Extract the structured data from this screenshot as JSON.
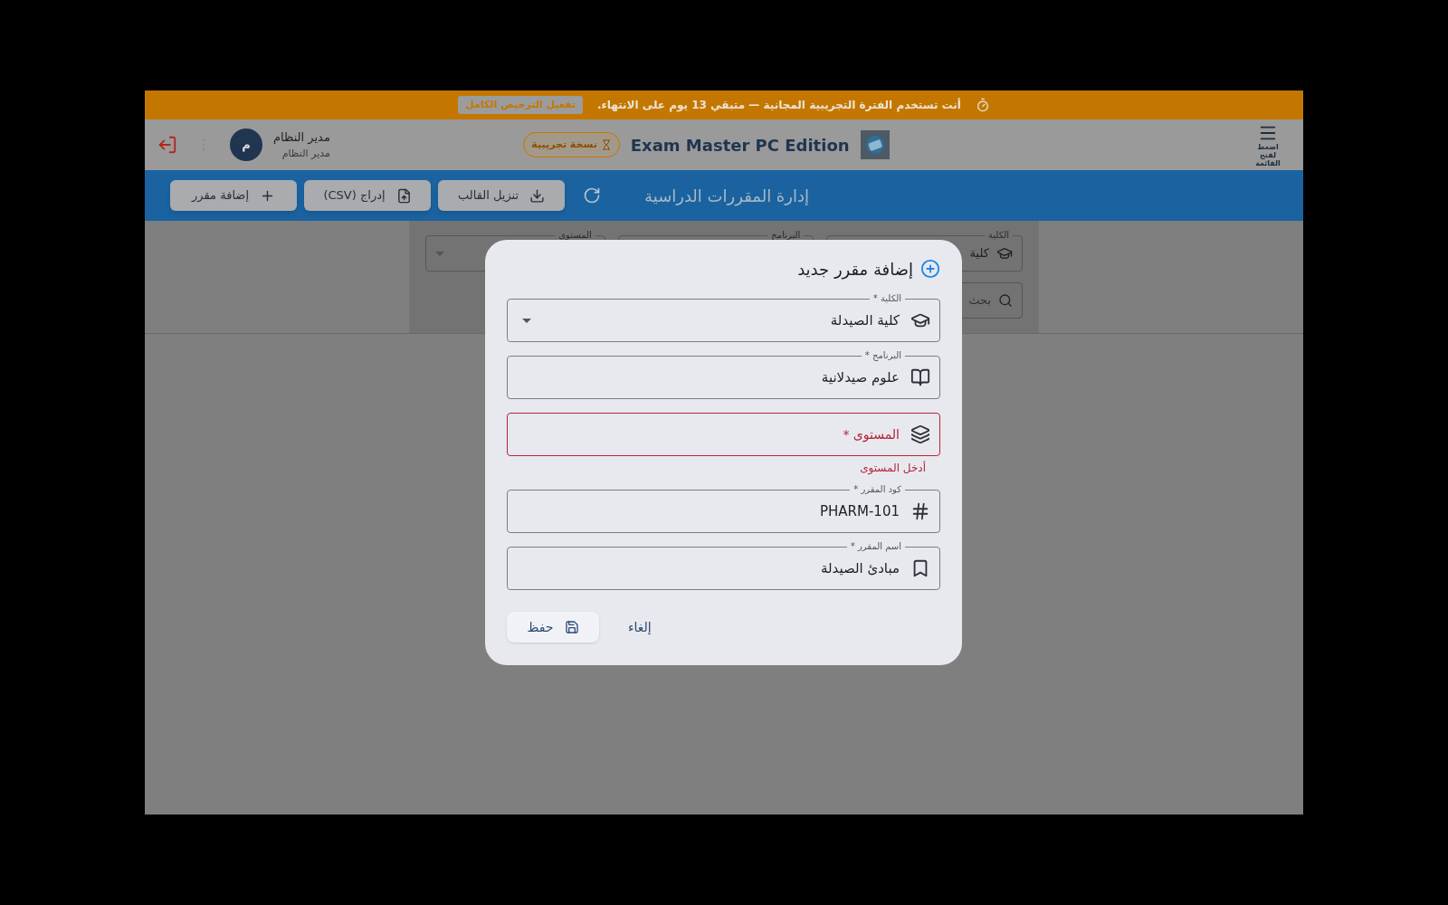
{
  "trial_banner": {
    "message": "أنت تستخدم الفترة التجريبية المجانية — متبقي 13 يوم على الانتهاء.",
    "activate_button": "تفعيل الترخيص الكامل"
  },
  "header": {
    "menu_label": "اضغط لفتح القائمة",
    "app_title": "Exam Master PC Edition",
    "trial_badge": "نسخة تجريبية",
    "user": {
      "avatar": "م",
      "name": "مدير النظام",
      "role": "مدير النظام"
    }
  },
  "toolbar": {
    "title": "إدارة المقررات الدراسية",
    "buttons": [
      {
        "kind": "download",
        "label": "تنزيل القالب"
      },
      {
        "kind": "import",
        "label": "إدراج (CSV)"
      },
      {
        "kind": "add",
        "label": "إضافة مقرر"
      }
    ]
  },
  "filters": {
    "fields": [
      {
        "kind": "faculty",
        "label": "الكلية",
        "value": "كلية"
      },
      {
        "kind": "program",
        "label": "البرنامج"
      },
      {
        "kind": "level",
        "label": "المستوى"
      }
    ],
    "search": {
      "placeholder": "بحث"
    }
  },
  "dialog": {
    "title": "إضافة مقرر جديد",
    "fields": [
      {
        "kind": "select",
        "label": "الكلية *",
        "value": "كلية الصيدلة",
        "error": false
      },
      {
        "kind": "text",
        "label": "البرنامج *",
        "value": "علوم صيدلانية",
        "error": false
      },
      {
        "kind": "text",
        "label": "المستوى *",
        "error": true,
        "helper": "أدخل المستوى"
      },
      {
        "kind": "text",
        "label": "كود المقرر *",
        "value": "PHARM-101",
        "error": false
      },
      {
        "kind": "text",
        "label": "اسم المقرر *",
        "value": "مبادئ الصيدلة",
        "error": false
      }
    ],
    "buttons": [
      {
        "kind": "cancel",
        "label": "إلغاء"
      },
      {
        "kind": "save",
        "label": "حفظ"
      }
    ]
  }
}
